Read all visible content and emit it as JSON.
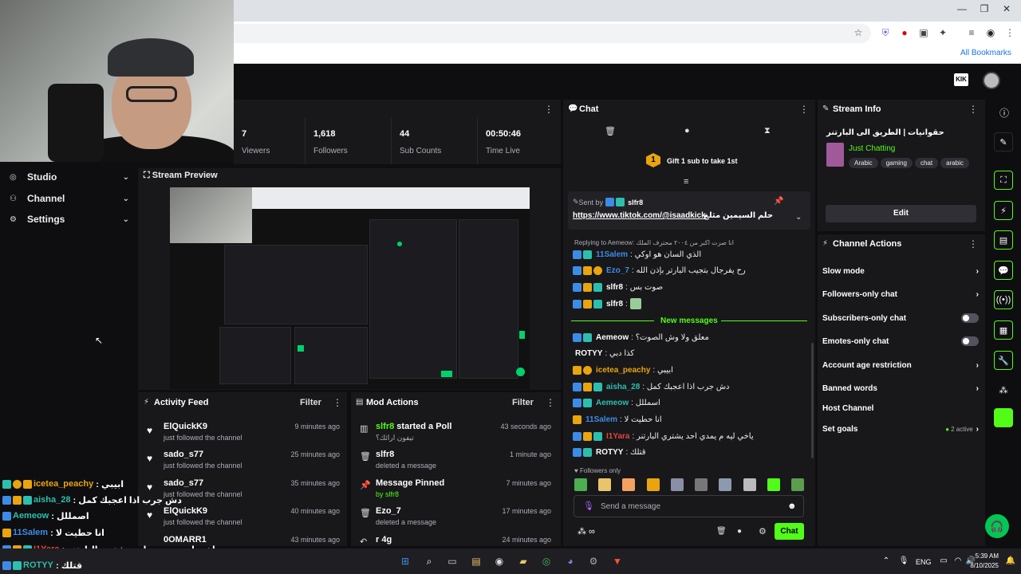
{
  "browser": {
    "bookmarks_label": "All Bookmarks"
  },
  "stats": [
    {
      "value": "7",
      "label": "Viewers"
    },
    {
      "value": "1,618",
      "label": "Followers"
    },
    {
      "value": "44",
      "label": "Sub Counts"
    },
    {
      "value": "00:50:46",
      "label": "Time Live"
    }
  ],
  "nav": {
    "items": [
      {
        "label": "Studio"
      },
      {
        "label": "Channel"
      },
      {
        "label": "Settings"
      }
    ]
  },
  "preview": {
    "title": "Stream Preview"
  },
  "activity": {
    "title": "Activity Feed",
    "filter": "Filter",
    "items": [
      {
        "name": "ElQuickK9",
        "desc": "just followed the channel",
        "time": "9 minutes ago"
      },
      {
        "name": "sado_s77",
        "desc": "just followed the channel",
        "time": "25 minutes ago"
      },
      {
        "name": "sado_s77",
        "desc": "just followed the channel",
        "time": "35 minutes ago"
      },
      {
        "name": "ElQuickK9",
        "desc": "just followed the channel",
        "time": "40 minutes ago"
      },
      {
        "name": "0OMARR1",
        "desc": "",
        "time": "43 minutes ago"
      }
    ]
  },
  "mod": {
    "title": "Mod Actions",
    "filter": "Filter",
    "items": [
      {
        "name": "slfr8",
        "name_suffix": " started a Poll",
        "desc": "تيفون ارائك؟",
        "time": "43 seconds ago"
      },
      {
        "name": "slfr8",
        "name_suffix": "",
        "desc": "deleted a message",
        "time": "1 minute ago"
      },
      {
        "name": "Message Pinned",
        "name_suffix": "",
        "desc": "by slfr8",
        "time": "7 minutes ago"
      },
      {
        "name": "Ezo_7",
        "name_suffix": "",
        "desc": "deleted a message",
        "time": "17 minutes ago"
      },
      {
        "name": "r 4g",
        "name_suffix": "",
        "desc": "",
        "time": "24 minutes ago"
      }
    ]
  },
  "chat": {
    "title": "Chat",
    "gift": "Gift 1 sub to take 1st",
    "gift_count": "1",
    "pinned_by_label": "Sent by",
    "pinned_by": "slfr8",
    "pinned_link": "https://www.tiktok.com/@isaadkick",
    "pinned_text": "حلم السيمين مثلغ",
    "reply_to": "Replying to Aemeow: انا صرت اكبر من ٢٠٠٤ محترف الملك",
    "new_messages": "New messages",
    "followers_only": "Followers only",
    "placeholder": "Send a message",
    "send": "Chat",
    "messages_top": [
      {
        "user": "11Salem",
        "color": "#3c8ce7",
        "text": "الذي السان هو اوكي"
      },
      {
        "user": "Ezo_7",
        "color": "#3c8ce7",
        "text": "رح يفرجال بتجيب البارتر بإذن الله"
      },
      {
        "user": "slfr8",
        "color": "#ffffff",
        "text": "صوت بس"
      },
      {
        "user": "slfr8",
        "color": "#ffffff",
        "text": ""
      }
    ],
    "messages_bottom": [
      {
        "user": "Aemeow",
        "color": "#ffffff",
        "text": "معلق ولا وش الصوت؟"
      },
      {
        "user": "ROTYY",
        "color": "#ffffff",
        "text": "كذا دبي"
      },
      {
        "user": "icetea_peachy",
        "color": "#e9a40e",
        "text": "ابيبي"
      },
      {
        "user": "aisha_28",
        "color": "#2dbfae",
        "text": "دش جرب اذا اعجبك كمل"
      },
      {
        "user": "Aemeow",
        "color": "#2dbfae",
        "text": "اسمللل"
      },
      {
        "user": "11Salem",
        "color": "#3c8ce7",
        "text": "انا حطيت لا"
      },
      {
        "user": "I1Yara",
        "color": "#e0463a",
        "text": "ياخي ليه م يمدي احد يشتري البارتنر"
      },
      {
        "user": "ROTYY",
        "color": "#ffffff",
        "text": "قتلك"
      }
    ]
  },
  "stream_info": {
    "title": "Stream Info",
    "stream_title": "حقوانيات | الطريق الى البارتنر",
    "category": "Just Chatting",
    "tags": [
      "Arabic",
      "gaming",
      "chat",
      "arabic"
    ],
    "edit": "Edit"
  },
  "channel_actions": {
    "title": "Channel Actions",
    "items": [
      {
        "label": "Slow mode",
        "kind": "chev"
      },
      {
        "label": "Followers-only chat",
        "kind": "chev"
      },
      {
        "label": "Subscribers-only chat",
        "kind": "toggle"
      },
      {
        "label": "Emotes-only chat",
        "kind": "toggle"
      },
      {
        "label": "Account age restriction",
        "kind": "chev"
      },
      {
        "label": "Banned words",
        "kind": "chev"
      },
      {
        "label": "Host Channel",
        "kind": "none"
      },
      {
        "label": "Set goals",
        "kind": "goals"
      }
    ],
    "goals_active": "2 active"
  },
  "overlay": [
    {
      "user": "icetea_peachy",
      "color": "#e9a40e",
      "text": ": ابيبي"
    },
    {
      "user": "aisha_28",
      "color": "#2dbfae",
      "text": ": دش جرب اذا اعجبك كمل"
    },
    {
      "user": "Aemeow",
      "color": "#2dbfae",
      "text": ": اصمللل"
    },
    {
      "user": "11Salem",
      "color": "#3c8ce7",
      "text": ": انا حطيت لا"
    },
    {
      "user": "I1Yara",
      "color": "#e0463a",
      "text": ": ياخي ليه م يمدي احد يشتري البارتنر"
    },
    {
      "user": "ROTYY",
      "color": "#2dbfae",
      "text": ": قتلك"
    }
  ],
  "taskbar": {
    "lang": "ENG",
    "time": "5:39 AM",
    "date": "8/10/2025"
  },
  "colors": {
    "accent": "#53fc18",
    "bg": "#0e0e10",
    "panel": "#18181b"
  }
}
